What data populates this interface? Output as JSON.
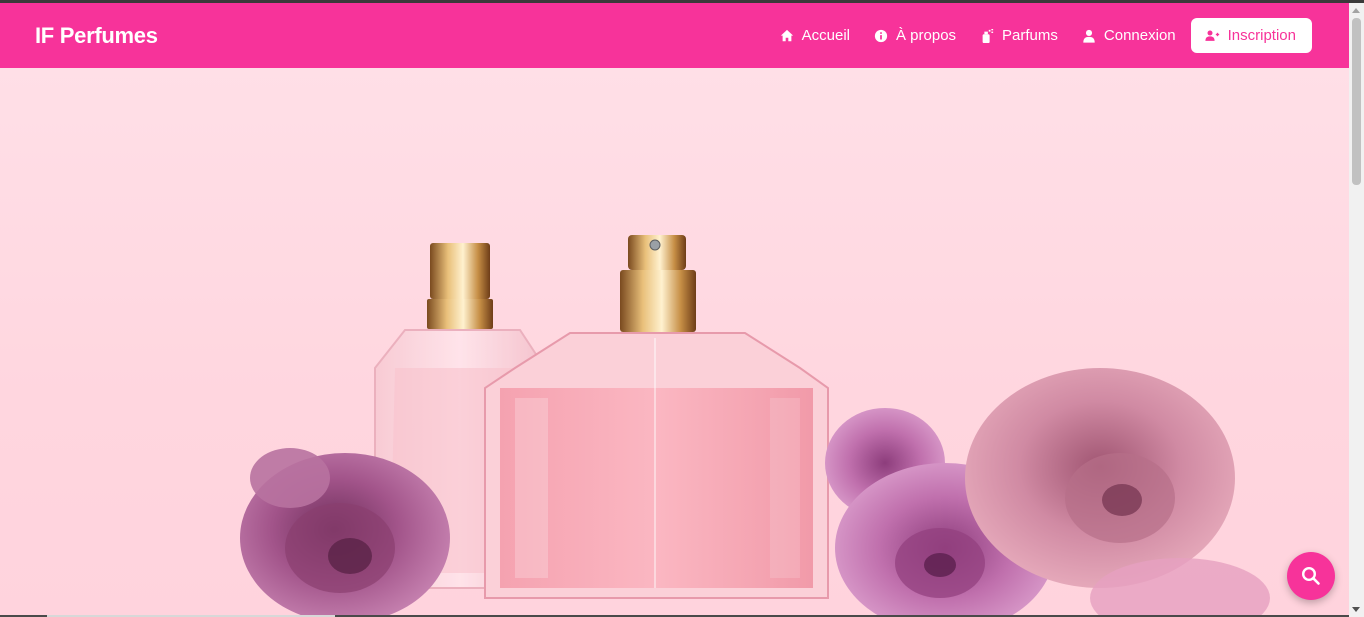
{
  "brand": {
    "name": "IF Perfumes"
  },
  "nav": {
    "items": [
      {
        "label": "Accueil",
        "icon": "home-icon"
      },
      {
        "label": "À propos",
        "icon": "info-icon"
      },
      {
        "label": "Parfums",
        "icon": "spray-bottle-icon"
      },
      {
        "label": "Connexion",
        "icon": "user-icon"
      }
    ],
    "signup": {
      "label": "Inscription",
      "icon": "user-plus-icon"
    }
  },
  "hero": {
    "image": "perfume-bottles-with-pink-roses"
  },
  "fab": {
    "icon": "search-icon"
  },
  "colors": {
    "accent": "#f7339a",
    "hero_bg": "#ffd9e2"
  }
}
